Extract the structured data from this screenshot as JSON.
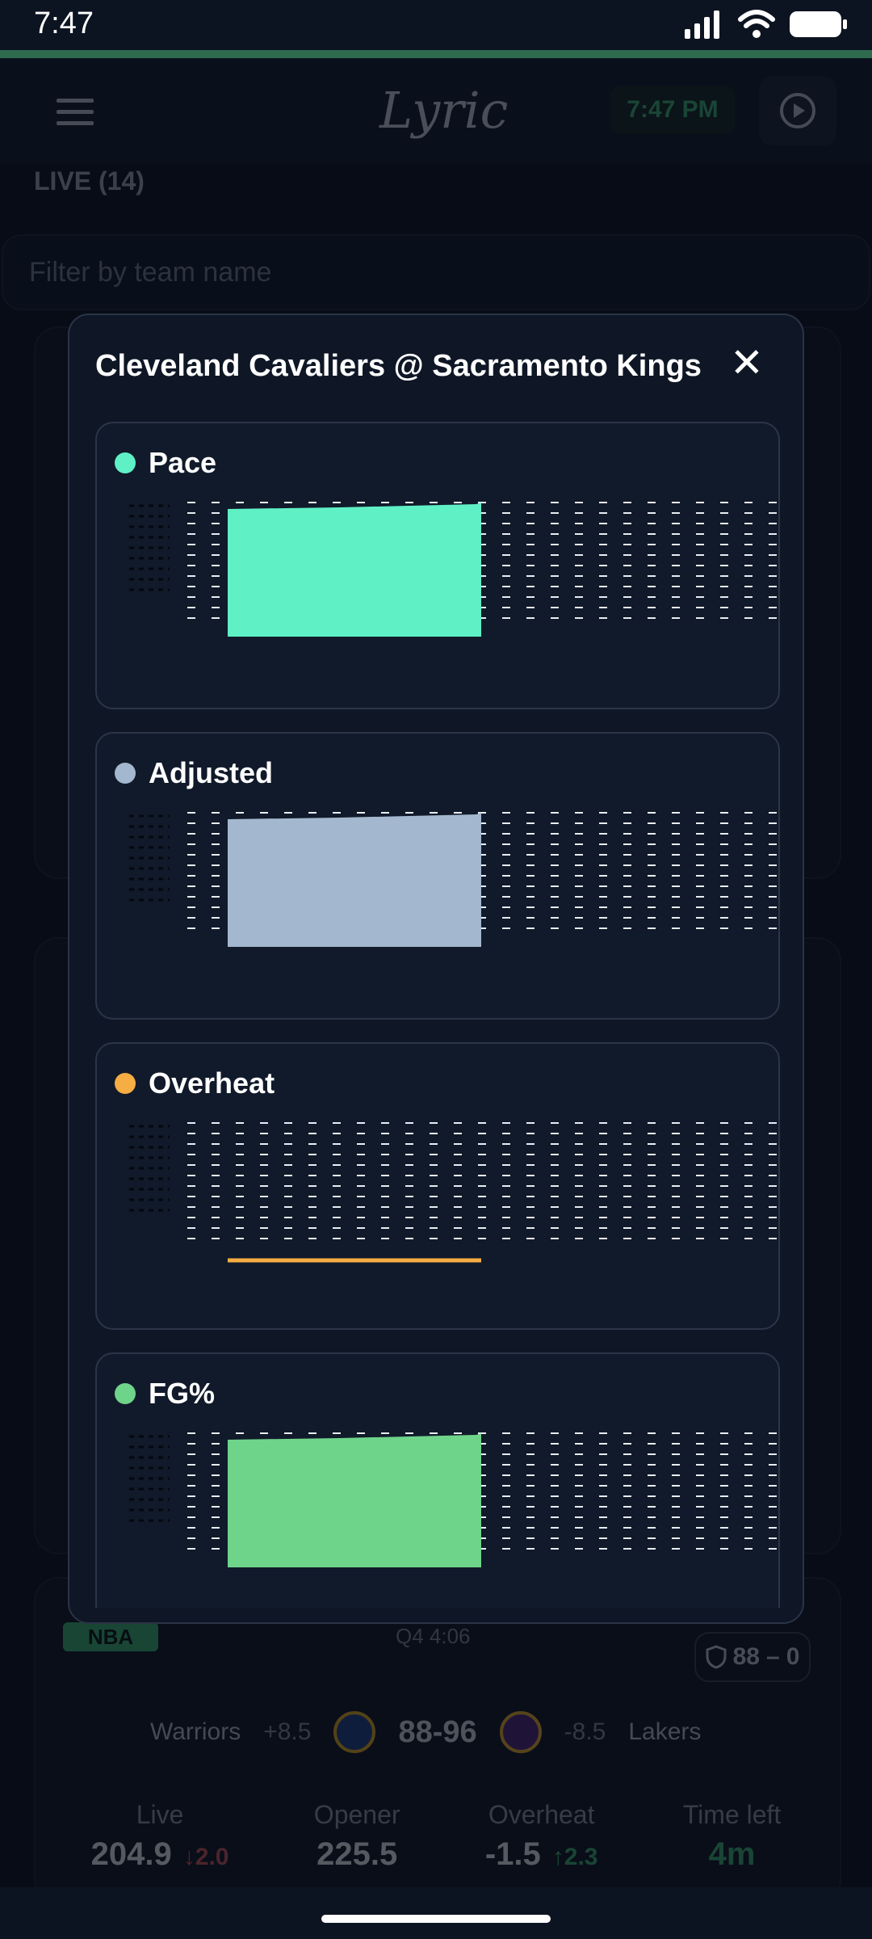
{
  "status_bar": {
    "time": "7:47"
  },
  "header": {
    "logo_text": "Lyric",
    "time_pill": "7:47 PM"
  },
  "live_label": "LIVE (14)",
  "filter": {
    "placeholder": "Filter by team name"
  },
  "game_card": {
    "league": "NBA",
    "clock": "Q4 4:06",
    "score_pill": {
      "value": "88",
      "sep": "–",
      "extra": "0"
    },
    "away_team": "Warriors",
    "away_spread": "+8.5",
    "score": "88-96",
    "home_team": "Lakers",
    "home_spread": "-8.5",
    "stats": [
      {
        "label": "Live",
        "value": "204.9",
        "delta": "2.0",
        "direction": "down"
      },
      {
        "label": "Opener",
        "value": "225.5"
      },
      {
        "label": "Overheat",
        "value": "-1.5",
        "delta": "2.3",
        "direction": "up"
      },
      {
        "label": "Time left",
        "value": "4m"
      }
    ]
  },
  "modal": {
    "title": "Cleveland Cavaliers @ Sacramento Kings",
    "metrics": [
      {
        "label": "Pace",
        "color": "#5ff0c5",
        "type": "area"
      },
      {
        "label": "Adjusted",
        "color": "#a3b8cf",
        "type": "area"
      },
      {
        "label": "Overheat",
        "color": "#f6ad43",
        "type": "line"
      },
      {
        "label": "FG%",
        "color": "#6ed48a",
        "type": "area"
      }
    ]
  },
  "colors": {
    "accent": "#3fbf79",
    "background": "#080c16",
    "modal": "#0f1726"
  }
}
